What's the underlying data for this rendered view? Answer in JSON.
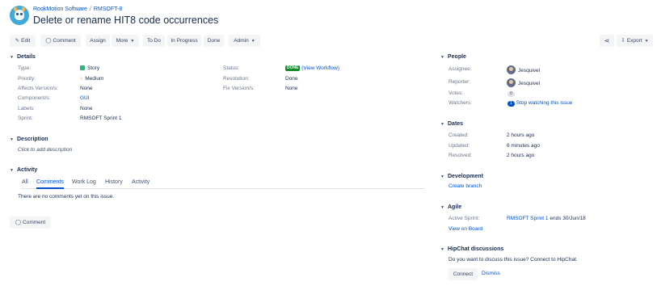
{
  "breadcrumb": {
    "project": "RookMotion Software",
    "separator": "/",
    "issue_key": "RMSOFT-8"
  },
  "issue": {
    "title": "Delete or rename HIT8 code occurrences"
  },
  "toolbar": {
    "edit": "Edit",
    "comment": "Comment",
    "assign": "Assign",
    "more": "More",
    "todo": "To Do",
    "in_progress": "In Progress",
    "done": "Done",
    "admin": "Admin",
    "export": "Export"
  },
  "details": {
    "heading": "Details",
    "type_label": "Type:",
    "type_value": "Story",
    "priority_label": "Priority:",
    "priority_value": "Medium",
    "affects_label": "Affects Version/s:",
    "affects_value": "None",
    "components_label": "Component/s:",
    "components_value": "GUI",
    "labels_label": "Labels:",
    "labels_value": "None",
    "sprint_label": "Sprint:",
    "sprint_value": "RMSOFT Sprint 1",
    "status_label": "Status:",
    "status_value": "DONE",
    "status_link": "(View Workflow)",
    "resolution_label": "Resolution:",
    "resolution_value": "Done",
    "fix_label": "Fix Version/s:",
    "fix_value": "None"
  },
  "description": {
    "heading": "Description",
    "placeholder": "Click to add description"
  },
  "activity": {
    "heading": "Activity",
    "tabs": [
      "All",
      "Comments",
      "Work Log",
      "History",
      "Activity"
    ],
    "empty": "There are no comments yet on this issue.",
    "comment_button": "Comment"
  },
  "people": {
    "heading": "People",
    "assignee_label": "Assignee:",
    "assignee": "Jesquivel",
    "reporter_label": "Reporter:",
    "reporter": "Jesquivel",
    "votes_label": "Votes:",
    "votes": "0",
    "watchers_label": "Watchers:",
    "watchers_count": "1",
    "watch_link": "Stop watching this issue"
  },
  "dates": {
    "heading": "Dates",
    "created_label": "Created:",
    "created": "2 hours ago",
    "updated_label": "Updated:",
    "updated": "6 minutes ago",
    "resolved_label": "Resolved:",
    "resolved": "2 hours ago"
  },
  "development": {
    "heading": "Development",
    "create_branch": "Create branch"
  },
  "agile": {
    "heading": "Agile",
    "active_sprint_label": "Active Sprint:",
    "active_sprint": "RMSOFT Sprint 1",
    "active_sprint_suffix": "ends 30/Jun/18",
    "view_board": "View on Board"
  },
  "hipchat": {
    "heading": "HipChat discussions",
    "prompt": "Do you want to discuss this issue? Connect to HipChat.",
    "connect": "Connect",
    "dismiss": "Dismiss"
  }
}
